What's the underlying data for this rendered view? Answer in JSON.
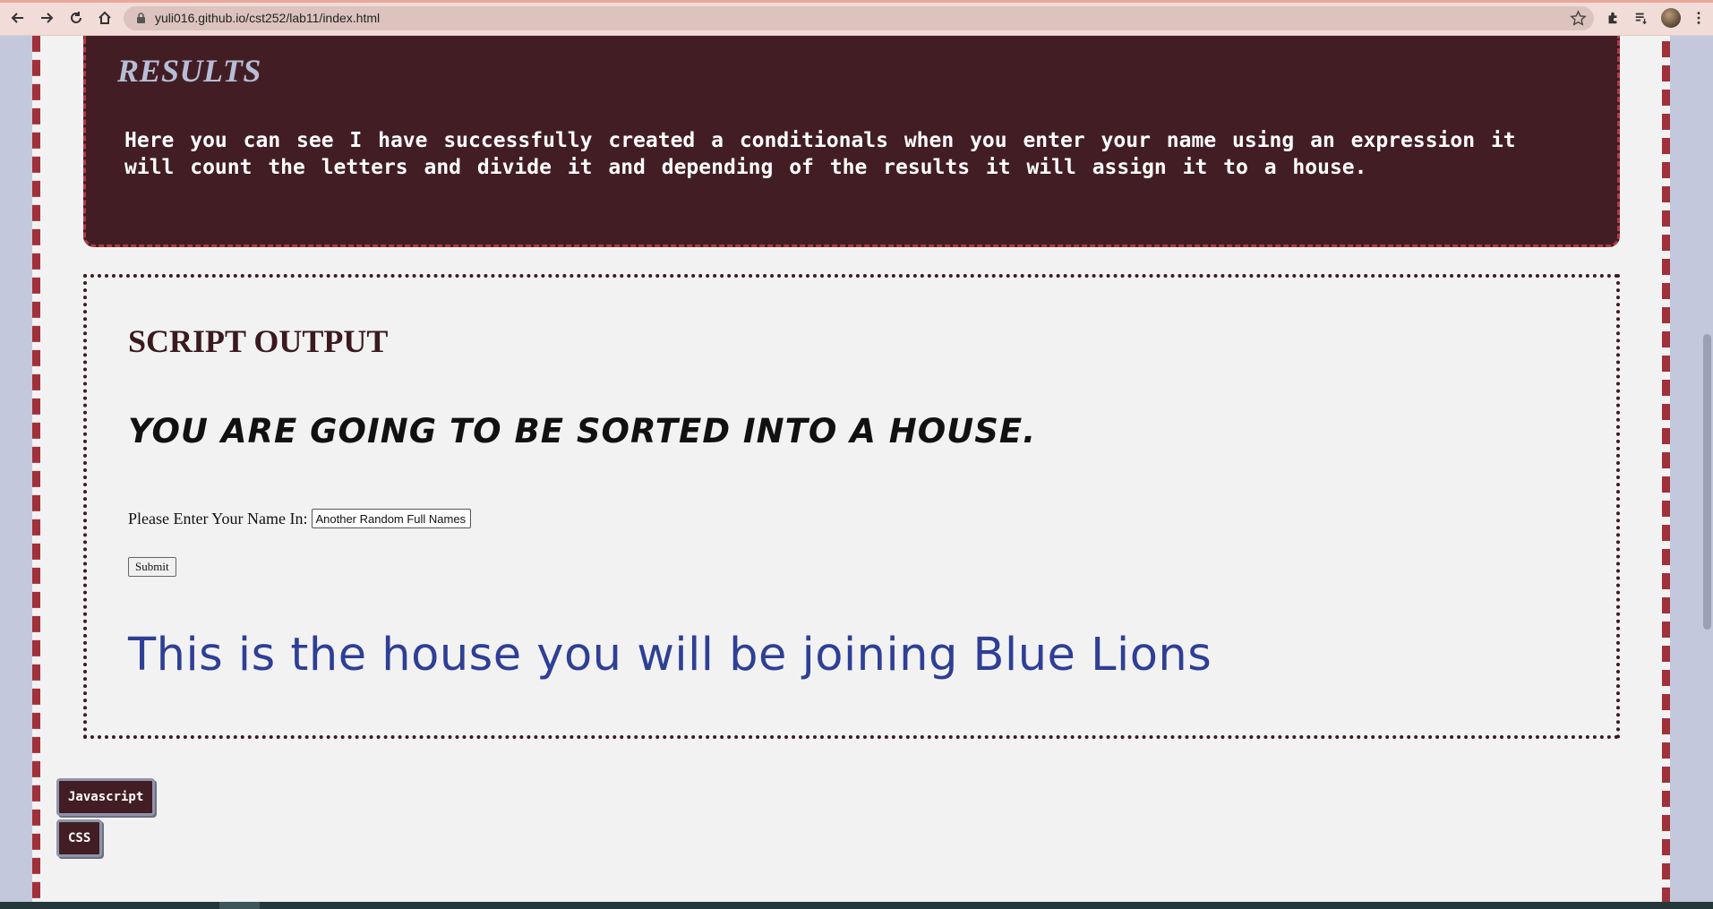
{
  "browser": {
    "url": "yuli016.github.io/cst252/lab11/index.html"
  },
  "results": {
    "title": "RESULTS",
    "text": "Here you can see I have successfully created a conditionals when you enter your name using an expression it will count the letters and divide it and depending of the results it will assign it to a house."
  },
  "output": {
    "title": "SCRIPT OUTPUT",
    "sorted_message": "YOU ARE GOING TO BE SORTED INTO A HOUSE.",
    "name_label": "Please Enter Your Name In:",
    "name_value": "Another Random Full Names",
    "submit_label": "Submit",
    "house_result": "This is the house you will be joining Blue Lions"
  },
  "links": {
    "javascript_label": "Javascript",
    "css_label": "CSS"
  },
  "colors": {
    "panel_border": "#a0313a",
    "results_bg": "#421e24",
    "house_text": "#2e3f95"
  }
}
